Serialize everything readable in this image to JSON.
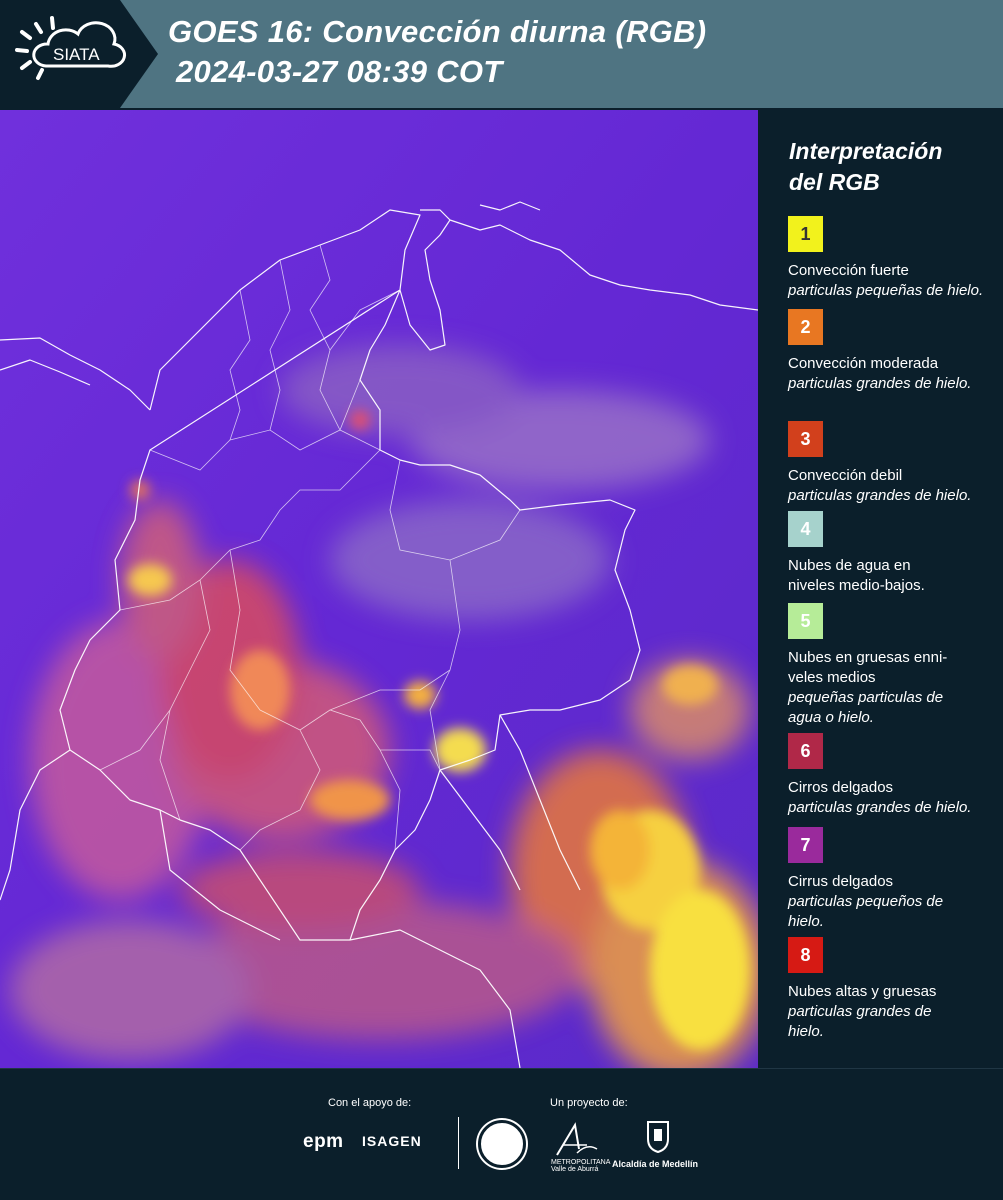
{
  "header": {
    "logo_text": "SIATA",
    "title": "GOES 16: Convección diurna (RGB)",
    "datetime": "2024-03-27 08:39 COT"
  },
  "legend": {
    "title_line1": "Interpretación",
    "title_line2": "del RGB",
    "items": [
      {
        "number": "1",
        "color": "#f2f21c",
        "text_color": "#333333",
        "label": "Convección fuerte",
        "sub": "particulas pequeñas de hielo."
      },
      {
        "number": "2",
        "color": "#e87722",
        "text_color": "#ffffff",
        "label": "Convección moderada",
        "sub": "particulas grandes de hielo."
      },
      {
        "number": "3",
        "color": "#d2401c",
        "text_color": "#ffffff",
        "label": "Convección debil",
        "sub": "particulas grandes de hielo."
      },
      {
        "number": "4",
        "color": "#a6d2cc",
        "text_color": "#ffffff",
        "label": "Nubes de agua en niveles medio-bajos.",
        "sub": ""
      },
      {
        "number": "5",
        "color": "#b6ec98",
        "text_color": "#ffffff",
        "label": "Nubes en gruesas enni-veles medios",
        "sub": "pequeñas particulas de agua o hielo."
      },
      {
        "number": "6",
        "color": "#b02848",
        "text_color": "#ffffff",
        "label": "Cirros delgados",
        "sub": "particulas grandes de hielo."
      },
      {
        "number": "7",
        "color": "#9a2a9c",
        "text_color": "#ffffff",
        "label": "Cirrus delgados",
        "sub": "particulas pequeños de hielo."
      },
      {
        "number": "8",
        "color": "#d61a14",
        "text_color": "#ffffff",
        "label": "Nubes altas y gruesas",
        "sub": "particulas grandes de hielo."
      }
    ]
  },
  "footer": {
    "support_label": "Con el apoyo de:",
    "project_label": "Un proyecto de:",
    "sponsor_1": "epm",
    "sponsor_2": "ISAGEN",
    "org_1_line1": "METROPOLITANA",
    "org_1_line2": "Valle de Aburrá",
    "org_2": "Alcaldía de Medellín"
  }
}
